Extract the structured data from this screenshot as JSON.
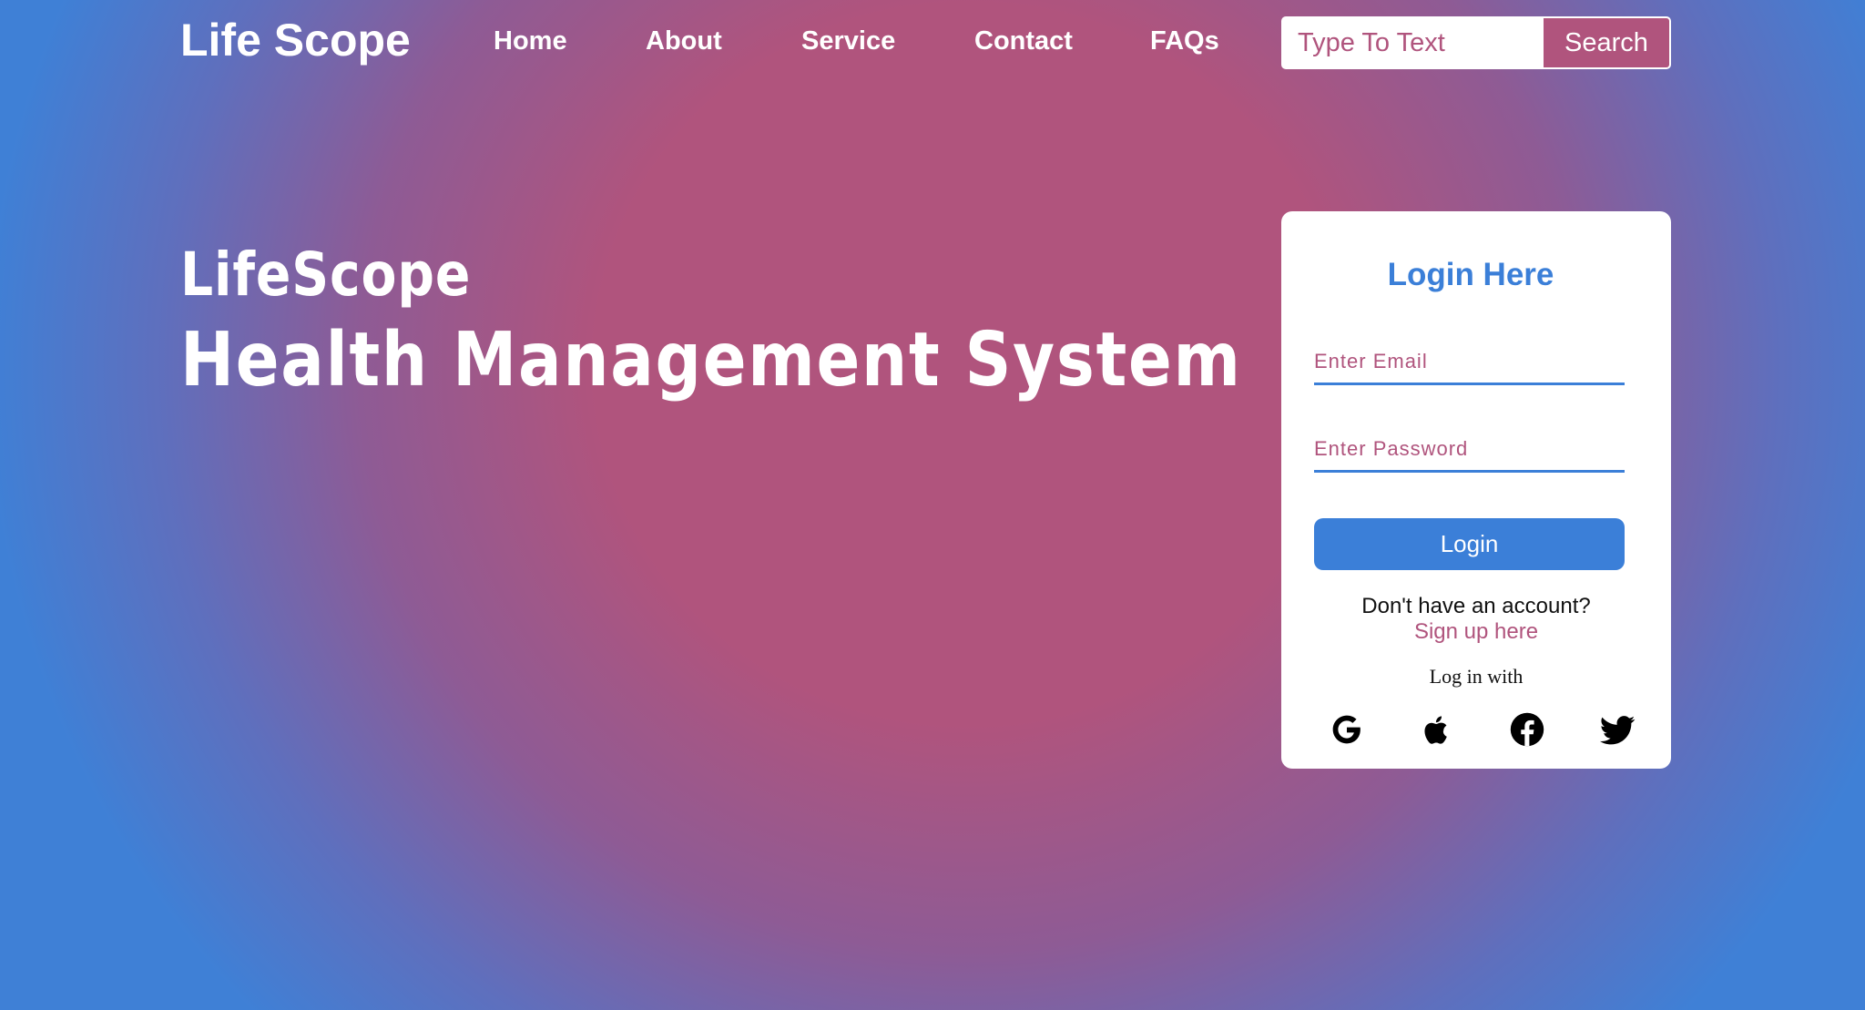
{
  "header": {
    "brand": "Life Scope",
    "nav": [
      "Home",
      "About",
      "Service",
      "Contact",
      "FAQs"
    ],
    "search": {
      "placeholder": "Type To Text",
      "button_label": "Search"
    }
  },
  "hero": {
    "line1": "LifeScope",
    "line2": "Health Management System"
  },
  "login": {
    "title": "Login Here",
    "email_placeholder": "Enter Email",
    "password_placeholder": "Enter Password",
    "button_label": "Login",
    "no_account_text": "Don't have an account?",
    "signup_link": "Sign up here",
    "login_with": "Log in with",
    "social_icons": [
      "google-icon",
      "apple-icon",
      "facebook-icon",
      "twitter-icon"
    ]
  },
  "colors": {
    "accent_blue": "#3b7fd8",
    "accent_pink": "#b0547d",
    "background_center": "#b0547d",
    "background_edge": "#3f80d6"
  }
}
